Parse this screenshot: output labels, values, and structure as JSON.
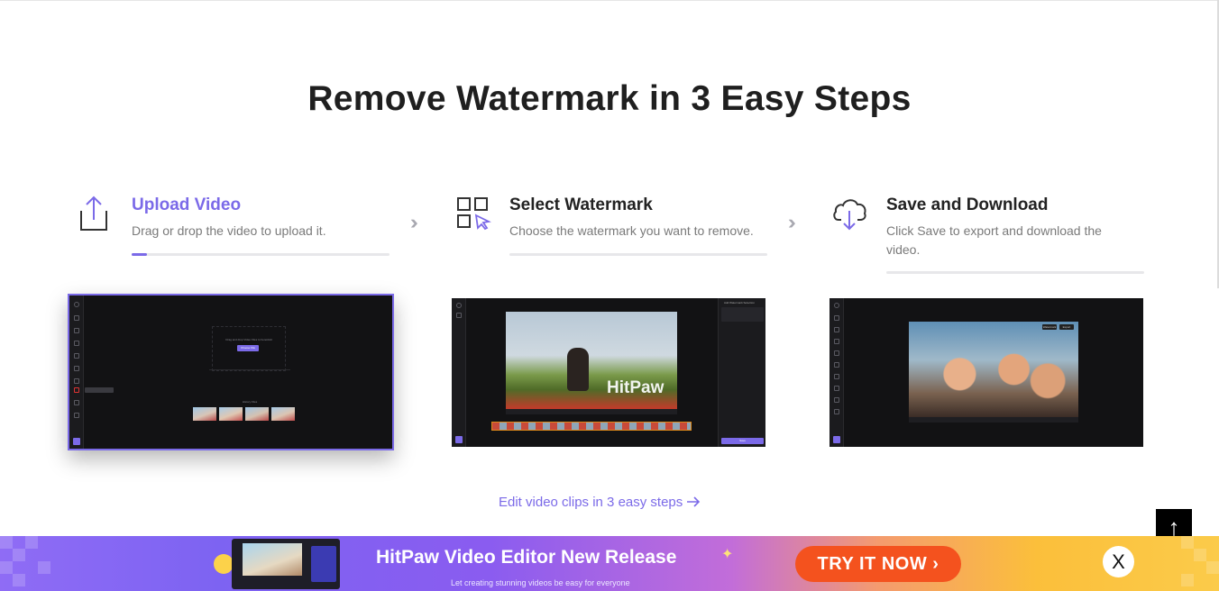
{
  "title": "Remove Watermark in 3 Easy Steps",
  "steps": [
    {
      "heading": "Upload Video",
      "desc": "Drag or drop the video to upload it.",
      "icon": "upload-icon",
      "active": true
    },
    {
      "heading": "Select Watermark",
      "desc": "Choose the watermark you want to remove.",
      "icon": "select-watermark-icon",
      "active": false
    },
    {
      "heading": "Save and Download",
      "desc": "Click Save to export and download the video.",
      "icon": "cloud-download-icon",
      "active": false
    }
  ],
  "shot1": {
    "drop_text": "Drag and drop Video Files to here/Add",
    "choose_button": "Choose File",
    "history_title": "History Files"
  },
  "shot2": {
    "watermark_text": "HitPaw",
    "panel_title": "Add Watermark Selection",
    "save_button": "Save"
  },
  "shot3": {
    "chip_left": "Watermark",
    "chip_right": "Export"
  },
  "edit_link": "Edit video clips in 3 easy steps",
  "banner": {
    "title": "HitPaw Video Editor New Release",
    "subtitle": "Let creating stunning videos be easy for everyone",
    "cta": "TRY IT NOW",
    "close_label": "X"
  },
  "back_to_top": "↑",
  "colors": {
    "accent": "#7b6ae8",
    "cta": "#f4521e",
    "heading": "#1f1f1f"
  }
}
